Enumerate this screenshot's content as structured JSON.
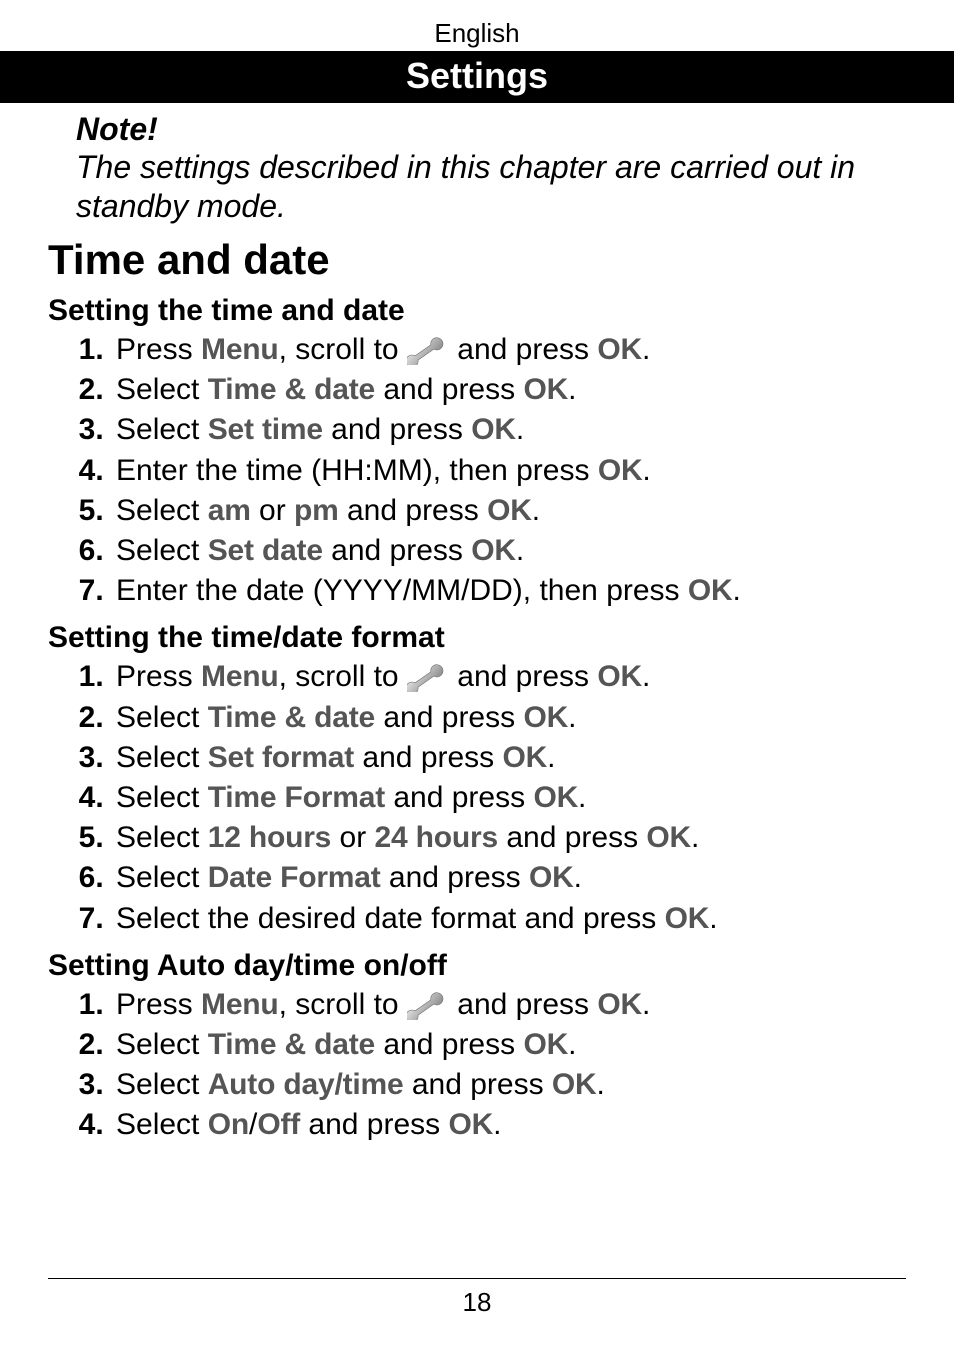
{
  "header": {
    "language": "English",
    "title": "Settings"
  },
  "note": {
    "label": "Note!",
    "body": "The settings described in this chapter are carried out in standby mode."
  },
  "section_title": "Time and date",
  "menu_labels": {
    "menu": "Menu",
    "ok": "OK",
    "time_and_date": "Time & date",
    "set_time": "Set time",
    "am": "am",
    "pm": "pm",
    "set_date": "Set date",
    "set_format": "Set format",
    "time_format": "Time Format",
    "h12": "12 hours",
    "h24": "24 hours",
    "date_format": "Date Format",
    "auto_daytime": "Auto day/time",
    "on": "On",
    "off": "Off"
  },
  "sub1": {
    "title": "Setting the time and date",
    "s1a": "Press ",
    "s1b": ", scroll to ",
    "s1c": " and press ",
    "s1d": ".",
    "s2a": "Select ",
    "s2b": " and press ",
    "s2c": ".",
    "s3a": "Select ",
    "s3b": " and press ",
    "s3c": ".",
    "s4a": "Enter the time (HH:MM), then press ",
    "s4b": ".",
    "s5a": "Select ",
    "s5b": " or ",
    "s5c": " and press ",
    "s5d": ".",
    "s6a": "Select ",
    "s6b": " and press ",
    "s6c": ".",
    "s7a": "Enter the date (YYYY/MM/DD), then press ",
    "s7b": "."
  },
  "sub2": {
    "title": "Setting the time/date format",
    "s1a": "Press ",
    "s1b": ", scroll to ",
    "s1c": " and press ",
    "s1d": ".",
    "s2a": "Select ",
    "s2b": " and press ",
    "s2c": ".",
    "s3a": "Select ",
    "s3b": " and press ",
    "s3c": ".",
    "s4a": "Select ",
    "s4b": " and press ",
    "s4c": ".",
    "s5a": "Select ",
    "s5b": " or ",
    "s5c": " and press ",
    "s5d": ".",
    "s6a": "Select ",
    "s6b": " and press ",
    "s6c": ".",
    "s7a": "Select the desired date format and press ",
    "s7b": "."
  },
  "sub3": {
    "title": "Setting Auto day/time on/off",
    "s1a": "Press ",
    "s1b": ", scroll to ",
    "s1c": " and press ",
    "s1d": ".",
    "s2a": "Select ",
    "s2b": " and press ",
    "s2c": ".",
    "s3a": "Select ",
    "s3b": " and press ",
    "s3c": ".",
    "s4a": "Select ",
    "s4b": "/",
    "s4c": " and press ",
    "s4d": "."
  },
  "page_number": "18"
}
